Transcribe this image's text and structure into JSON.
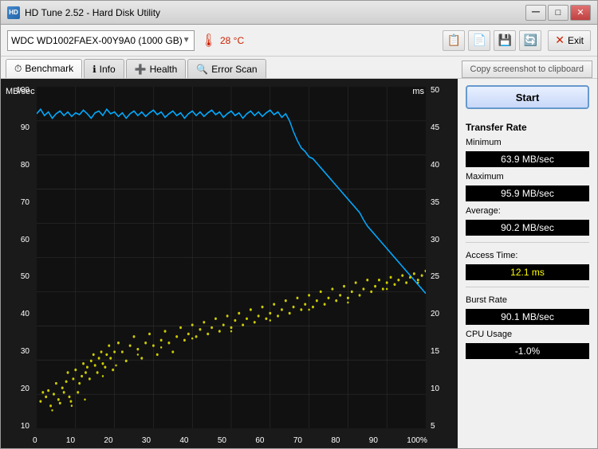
{
  "window": {
    "title": "HD Tune 2.52 - Hard Disk Utility",
    "icon": "HD"
  },
  "titlebar": {
    "minimize_label": "─",
    "maximize_label": "□",
    "close_label": "✕"
  },
  "toolbar": {
    "drive_name": "WDC WD1002FAEX-00Y9A0 (1000 GB)",
    "temperature": "28 °C",
    "temp_icon": "🌡"
  },
  "tabs": [
    {
      "id": "benchmark",
      "label": "Benchmark",
      "icon": "⏱",
      "active": true
    },
    {
      "id": "info",
      "label": "Info",
      "icon": "ℹ"
    },
    {
      "id": "health",
      "label": "Health",
      "icon": "➕"
    },
    {
      "id": "errorscan",
      "label": "Error Scan",
      "icon": "🔍"
    }
  ],
  "screenshot_btn": "Copy screenshot to clipboard",
  "chart": {
    "y_left_label": "MB/sec",
    "y_right_label": "ms",
    "y_left_values": [
      "100",
      "90",
      "80",
      "70",
      "60",
      "50",
      "40",
      "30",
      "20",
      "10"
    ],
    "y_right_values": [
      "50",
      "45",
      "40",
      "35",
      "30",
      "25",
      "20",
      "15",
      "10",
      "5"
    ],
    "x_values": [
      "0",
      "10",
      "20",
      "30",
      "40",
      "50",
      "60",
      "70",
      "80",
      "90",
      "100%"
    ]
  },
  "stats": {
    "start_label": "Start",
    "transfer_rate_label": "Transfer Rate",
    "minimum_label": "Minimum",
    "minimum_value": "63.9 MB/sec",
    "maximum_label": "Maximum",
    "maximum_value": "95.9 MB/sec",
    "average_label": "Average:",
    "average_value": "90.2 MB/sec",
    "access_time_label": "Access Time:",
    "access_time_value": "12.1 ms",
    "burst_rate_label": "Burst Rate",
    "burst_rate_value": "90.1 MB/sec",
    "cpu_usage_label": "CPU Usage",
    "cpu_usage_value": "-1.0%"
  }
}
